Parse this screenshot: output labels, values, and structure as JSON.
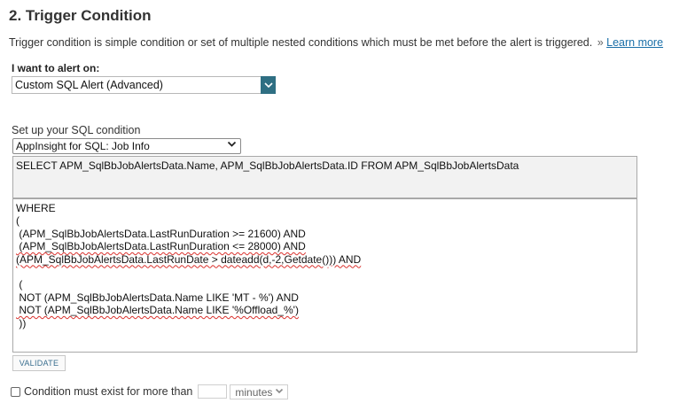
{
  "section": {
    "title": "2. Trigger Condition",
    "description": "Trigger condition is simple condition or set of multiple nested conditions which must be met before the alert is triggered.",
    "link_prefix": "»",
    "learn_more": "Learn more"
  },
  "alert_on": {
    "label": "I want to alert on:",
    "selected": "Custom SQL Alert (Advanced)",
    "button_icon": "chevron-down-icon",
    "accent_color": "#2f6f83"
  },
  "sql": {
    "label": "Set up your SQL condition",
    "source_selected": "AppInsight for SQL: Job Info",
    "select_statement": "SELECT APM_SqlBbJobAlertsData.Name, APM_SqlBbJobAlertsData.ID FROM APM_SqlBbJobAlertsData",
    "where_lines": [
      "WHERE",
      "(",
      " (APM_SqlBbJobAlertsData.LastRunDuration >= 21600) AND",
      " (APM_SqlBbJobAlertsData.LastRunDuration <= 28000) AND",
      "(APM_SqlBbJobAlertsData.LastRunDate > dateadd(d,-2,Getdate())) AND",
      "",
      " (",
      " NOT (APM_SqlBbJobAlertsData.Name LIKE 'MT - %') AND",
      " NOT (APM_SqlBbJobAlertsData.Name LIKE '%Offload_%')",
      " ))"
    ],
    "validate_label": "VALIDATE"
  },
  "duration": {
    "label": "Condition must exist for more than",
    "value": "",
    "unit_selected": "minutes"
  }
}
